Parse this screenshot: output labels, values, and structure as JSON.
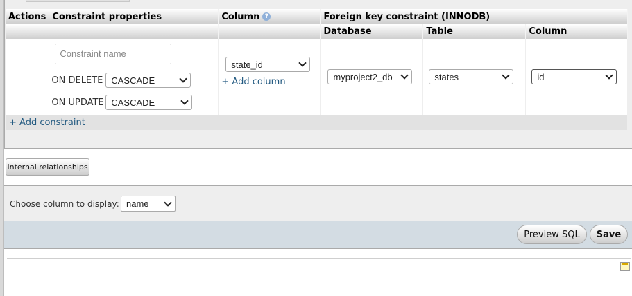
{
  "table": {
    "headers": {
      "actions": "Actions",
      "constraint_properties": "Constraint properties",
      "column": "Column",
      "foreign_key": "Foreign key constraint (INNODB)"
    },
    "subheaders": {
      "database": "Database",
      "table": "Table",
      "column": "Column"
    },
    "help_icon": "?"
  },
  "constraint": {
    "name_placeholder": "Constraint name",
    "on_delete_label": "ON DELETE",
    "on_delete_value": "CASCADE",
    "on_update_label": "ON UPDATE",
    "on_update_value": "CASCADE"
  },
  "column": {
    "selected": "state_id",
    "add_column": "+ Add column"
  },
  "foreign": {
    "database": "myproject2_db",
    "table": "states",
    "column": "id"
  },
  "add_constraint": "+ Add constraint",
  "internal_relationships": "Internal relationships",
  "display": {
    "label": "Choose column to display:",
    "selected": "name"
  },
  "buttons": {
    "preview_sql": "Preview SQL",
    "save": "Save"
  }
}
